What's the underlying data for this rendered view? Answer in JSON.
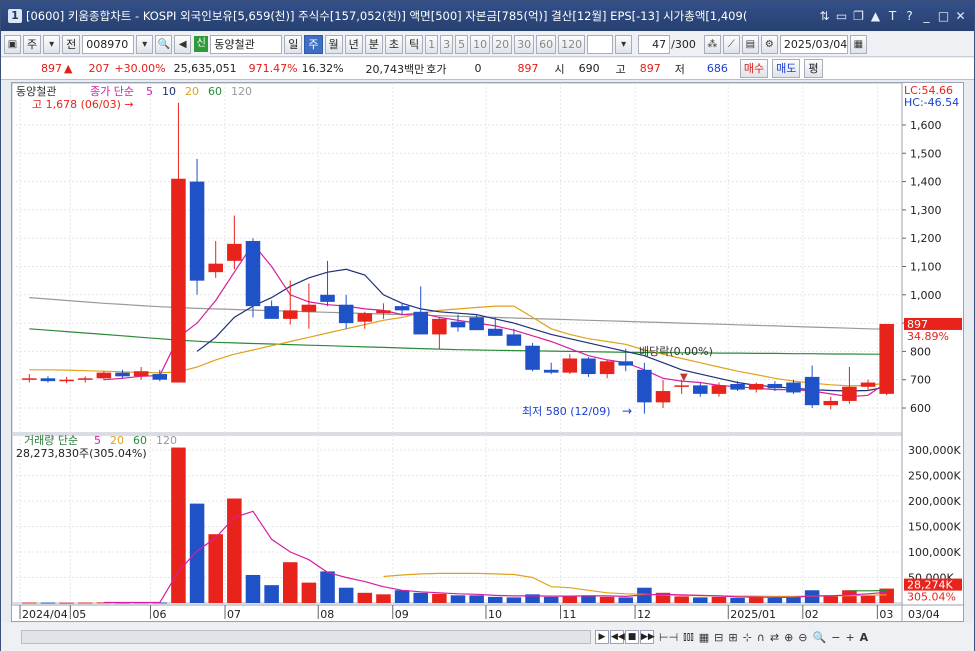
{
  "window": {
    "number": "1",
    "title": "[0600] 키움종합차트 - KOSPI 외국인보유[5,659(천)] 주식수[157,052(천)] 액면[500] 자본금[785(억)] 결산[12월] EPS[-13] 시가총액[1,409(",
    "controls": [
      "⇅",
      "▭",
      "❐",
      "▲",
      "T",
      "?",
      "_",
      "□",
      "✕"
    ]
  },
  "toolbar": {
    "period_label": "주",
    "market_label": "전",
    "code": "008970",
    "badge": "신",
    "stock_name": "동양철관",
    "period_buttons": [
      "일",
      "주",
      "월",
      "년",
      "분",
      "초",
      "틱"
    ],
    "active_period": "주",
    "minute_buttons": [
      "1",
      "3",
      "5",
      "10",
      "20",
      "30",
      "60",
      "120"
    ],
    "count": "47",
    "count_total": "/300",
    "date": "2025/03/04"
  },
  "info": {
    "price": "897",
    "change": "207",
    "change_pct": "+30.00%",
    "volume": "25,635,051",
    "vol_ratio": "971.47%",
    "turnover": "16.32%",
    "amount": "20,743백만",
    "hoga_label": "호가",
    "hoga_value": "0",
    "hoga_price": "897",
    "open_label": "시",
    "open": "690",
    "high_label": "고",
    "high": "897",
    "low_label": "저",
    "low": "686",
    "buy_button": "매수",
    "sell_button": "매도",
    "flat_button": "평"
  },
  "chart_data": {
    "type": "candlestick",
    "stock_label": "동양철관",
    "ma_legend": {
      "label": "종가 단순",
      "periods": [
        "5",
        "10",
        "20",
        "60",
        "120"
      ]
    },
    "high_note": "고 1,678 (06/03) →",
    "low_note": "최저 580 (12/09)",
    "dividend_note": "배당락(0.00%)",
    "lc": "LC:54.66",
    "hc": "HC:-46.54",
    "price_ticks": [
      "1,600",
      "1,500",
      "1,400",
      "1,300",
      "1,200",
      "1,100",
      "1,000",
      "900",
      "800",
      "700",
      "600"
    ],
    "price_tick_values": [
      1600,
      1500,
      1400,
      1300,
      1200,
      1100,
      1000,
      900,
      800,
      700,
      600
    ],
    "current_price_tag": "897",
    "current_pct_tag": "34.89%",
    "ylim": [
      540,
      1720
    ],
    "colors": {
      "up": "#e8231b",
      "down": "#1f52c7",
      "ma5": "#d61ea1",
      "ma10": "#1d2f7a",
      "ma20": "#e0a21c",
      "ma60": "#2a8a3a",
      "ma120": "#999999"
    },
    "candles": [
      {
        "o": 700,
        "h": 720,
        "l": 690,
        "c": 705
      },
      {
        "o": 705,
        "h": 712,
        "l": 690,
        "c": 695
      },
      {
        "o": 695,
        "h": 710,
        "l": 688,
        "c": 700
      },
      {
        "o": 700,
        "h": 712,
        "l": 690,
        "c": 705
      },
      {
        "o": 705,
        "h": 730,
        "l": 698,
        "c": 725
      },
      {
        "o": 725,
        "h": 735,
        "l": 705,
        "c": 712
      },
      {
        "o": 712,
        "h": 745,
        "l": 700,
        "c": 730
      },
      {
        "o": 720,
        "h": 735,
        "l": 695,
        "c": 700
      },
      {
        "o": 690,
        "h": 1678,
        "l": 690,
        "c": 1410
      },
      {
        "o": 1400,
        "h": 1480,
        "l": 1000,
        "c": 1050
      },
      {
        "o": 1080,
        "h": 1190,
        "l": 1060,
        "c": 1110
      },
      {
        "o": 1120,
        "h": 1280,
        "l": 1090,
        "c": 1180
      },
      {
        "o": 1190,
        "h": 1200,
        "l": 920,
        "c": 960
      },
      {
        "o": 960,
        "h": 980,
        "l": 920,
        "c": 915
      },
      {
        "o": 915,
        "h": 1050,
        "l": 895,
        "c": 945
      },
      {
        "o": 940,
        "h": 1040,
        "l": 880,
        "c": 965
      },
      {
        "o": 1000,
        "h": 1120,
        "l": 960,
        "c": 975
      },
      {
        "o": 965,
        "h": 1000,
        "l": 880,
        "c": 900
      },
      {
        "o": 905,
        "h": 940,
        "l": 880,
        "c": 935
      },
      {
        "o": 935,
        "h": 970,
        "l": 915,
        "c": 945
      },
      {
        "o": 960,
        "h": 970,
        "l": 930,
        "c": 945
      },
      {
        "o": 940,
        "h": 1030,
        "l": 880,
        "c": 860
      },
      {
        "o": 860,
        "h": 920,
        "l": 810,
        "c": 915
      },
      {
        "o": 905,
        "h": 930,
        "l": 870,
        "c": 885
      },
      {
        "o": 920,
        "h": 930,
        "l": 880,
        "c": 875
      },
      {
        "o": 880,
        "h": 920,
        "l": 860,
        "c": 855
      },
      {
        "o": 860,
        "h": 880,
        "l": 820,
        "c": 820
      },
      {
        "o": 820,
        "h": 830,
        "l": 730,
        "c": 735
      },
      {
        "o": 735,
        "h": 760,
        "l": 720,
        "c": 725
      },
      {
        "o": 725,
        "h": 790,
        "l": 720,
        "c": 775
      },
      {
        "o": 775,
        "h": 780,
        "l": 710,
        "c": 720
      },
      {
        "o": 720,
        "h": 770,
        "l": 705,
        "c": 765
      },
      {
        "o": 765,
        "h": 810,
        "l": 730,
        "c": 750
      },
      {
        "o": 735,
        "h": 760,
        "l": 580,
        "c": 620
      },
      {
        "o": 620,
        "h": 700,
        "l": 600,
        "c": 660
      },
      {
        "o": 675,
        "h": 700,
        "l": 650,
        "c": 680
      },
      {
        "o": 680,
        "h": 690,
        "l": 640,
        "c": 650
      },
      {
        "o": 650,
        "h": 690,
        "l": 640,
        "c": 680
      },
      {
        "o": 685,
        "h": 695,
        "l": 660,
        "c": 665
      },
      {
        "o": 665,
        "h": 690,
        "l": 655,
        "c": 685
      },
      {
        "o": 685,
        "h": 695,
        "l": 660,
        "c": 670
      },
      {
        "o": 690,
        "h": 700,
        "l": 650,
        "c": 655
      },
      {
        "o": 710,
        "h": 750,
        "l": 600,
        "c": 610
      },
      {
        "o": 610,
        "h": 640,
        "l": 595,
        "c": 625
      },
      {
        "o": 625,
        "h": 745,
        "l": 615,
        "c": 675
      },
      {
        "o": 675,
        "h": 700,
        "l": 660,
        "c": 690
      },
      {
        "o": 650,
        "h": 897,
        "l": 645,
        "c": 897
      }
    ],
    "ma5": [
      null,
      null,
      null,
      null,
      700,
      705,
      712,
      715,
      850,
      900,
      980,
      1080,
      1180,
      1100,
      1000,
      975,
      965,
      960,
      950,
      945,
      930,
      935,
      920,
      910,
      900,
      890,
      875,
      855,
      835,
      810,
      785,
      770,
      760,
      735,
      705,
      695,
      690,
      680,
      675,
      670,
      665,
      665,
      660,
      650,
      640,
      645,
      690
    ],
    "ma10": [
      null,
      null,
      null,
      null,
      null,
      null,
      null,
      null,
      null,
      800,
      850,
      920,
      960,
      990,
      1030,
      1060,
      1080,
      1090,
      1070,
      1000,
      970,
      950,
      940,
      935,
      930,
      915,
      900,
      880,
      860,
      845,
      830,
      815,
      800,
      785,
      760,
      735,
      720,
      705,
      690,
      680,
      675,
      670,
      665,
      662,
      660,
      662,
      675
    ],
    "ma20": [
      735,
      735,
      734,
      732,
      730,
      728,
      726,
      724,
      728,
      745,
      770,
      790,
      805,
      820,
      835,
      850,
      865,
      880,
      895,
      910,
      920,
      935,
      945,
      950,
      955,
      960,
      960,
      920,
      880,
      860,
      845,
      835,
      825,
      805,
      790,
      775,
      760,
      745,
      730,
      718,
      705,
      695,
      688,
      682,
      678,
      680,
      688
    ],
    "ma60": [
      880,
      875,
      870,
      865,
      860,
      855,
      850,
      845,
      840,
      836,
      832,
      830,
      828,
      826,
      824,
      822,
      820,
      818,
      816,
      814,
      812,
      810,
      808,
      806,
      805,
      804,
      803,
      802,
      801,
      800,
      799,
      798,
      797,
      796,
      796,
      795,
      795,
      794,
      794,
      793,
      793,
      792,
      792,
      791,
      791,
      790,
      790
    ],
    "ma120": [
      990,
      985,
      980,
      975,
      970,
      966,
      962,
      958,
      955,
      952,
      950,
      948,
      946,
      944,
      942,
      940,
      938,
      936,
      934,
      932,
      930,
      928,
      926,
      924,
      922,
      920,
      918,
      916,
      914,
      912,
      910,
      908,
      906,
      904,
      902,
      900,
      898,
      896,
      894,
      892,
      890,
      888,
      886,
      884,
      882,
      880,
      878
    ],
    "volume": {
      "label": "거래량 단순",
      "periods": [
        "5",
        "20",
        "60",
        "120"
      ],
      "value_label": "28,273,830주(305.04%)",
      "ticks": [
        "300,000K",
        "250,000K",
        "200,000K",
        "150,000K",
        "100,000K",
        "50,000K"
      ],
      "tick_values": [
        300000,
        250000,
        200000,
        150000,
        100000,
        50000
      ],
      "current_tag": "28,274K",
      "current_pct_tag": "305.04%",
      "ylim": [
        0,
        310000
      ],
      "values": [
        900,
        800,
        700,
        900,
        1200,
        900,
        1100,
        1000,
        305000,
        195000,
        135000,
        205000,
        55000,
        35000,
        80000,
        40000,
        62000,
        30000,
        20000,
        17000,
        25000,
        20000,
        18000,
        15000,
        15000,
        12000,
        11000,
        17000,
        12000,
        14000,
        15000,
        12000,
        11000,
        30000,
        20000,
        13000,
        11000,
        12000,
        10000,
        11000,
        10000,
        11000,
        25000,
        15000,
        25000,
        14000,
        28274
      ],
      "ma5": [
        null,
        null,
        null,
        null,
        900,
        900,
        920,
        960,
        62000,
        102000,
        128000,
        168000,
        180000,
        125000,
        100000,
        85000,
        60000,
        50000,
        42000,
        32000,
        25000,
        22000,
        20000,
        18000,
        17000,
        15000,
        14000,
        14000,
        13500,
        13500,
        14000,
        14000,
        13000,
        16000,
        17000,
        16000,
        15000,
        14000,
        12000,
        11500,
        11000,
        11000,
        14000,
        14000,
        16000,
        18000,
        21000
      ],
      "ma20": [
        null,
        null,
        null,
        null,
        null,
        null,
        null,
        null,
        null,
        null,
        null,
        null,
        null,
        null,
        null,
        null,
        null,
        null,
        null,
        52000,
        55000,
        57000,
        58000,
        58000,
        58000,
        57000,
        56000,
        50000,
        32000,
        30000,
        25000,
        20000,
        18000,
        17000,
        16000,
        15000,
        14500,
        14000,
        13500,
        13500,
        13000,
        13000,
        13500,
        14000,
        14500,
        15000,
        16000
      ],
      "ma60": [
        null,
        null,
        null,
        null,
        null,
        null,
        null,
        null,
        null,
        null,
        null,
        null,
        null,
        null,
        null,
        null,
        null,
        null,
        null,
        null,
        null,
        null,
        null,
        null,
        null,
        null,
        null,
        null,
        null,
        null,
        null,
        null,
        null,
        null,
        null,
        null,
        null,
        null,
        null,
        null,
        null,
        null,
        null,
        null,
        24000,
        24000,
        24500
      ]
    },
    "x_labels": [
      {
        "i": 0,
        "t": "2024/04"
      },
      {
        "i": 2.7,
        "t": "05"
      },
      {
        "i": 7,
        "t": "06"
      },
      {
        "i": 11,
        "t": "07"
      },
      {
        "i": 16,
        "t": "08"
      },
      {
        "i": 20,
        "t": "09"
      },
      {
        "i": 25,
        "t": "10"
      },
      {
        "i": 29,
        "t": "11"
      },
      {
        "i": 33,
        "t": "12"
      },
      {
        "i": 38,
        "t": "2025/01"
      },
      {
        "i": 42,
        "t": "02"
      },
      {
        "i": 46,
        "t": "03"
      }
    ],
    "x_axis_right": "03/04"
  }
}
